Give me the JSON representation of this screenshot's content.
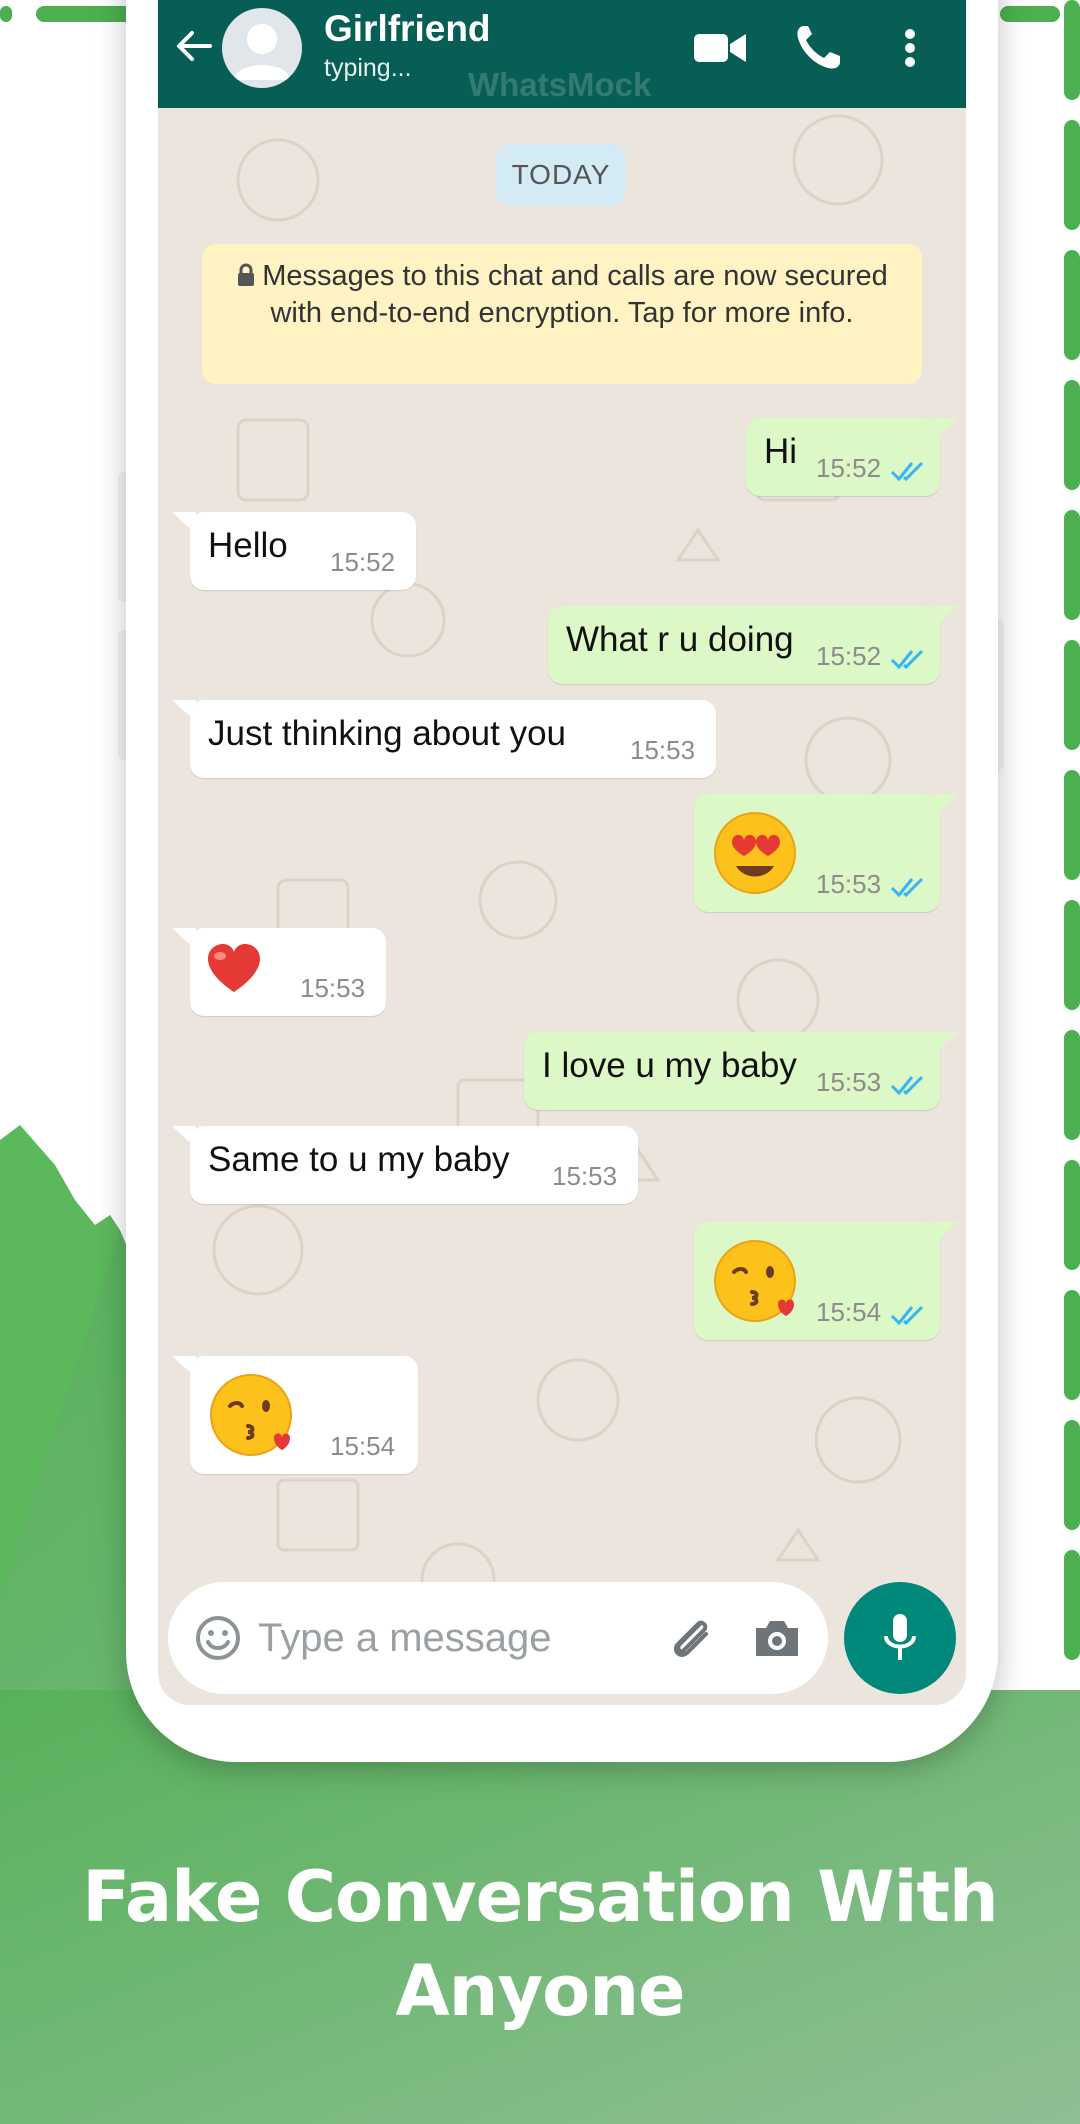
{
  "chat": {
    "contact_name": "Girlfriend",
    "contact_status": "typing...",
    "watermark": "WhatsMock",
    "date_label": "TODAY",
    "encryption_notice": "Messages to this chat and calls are now secured with end-to-end encryption. Tap for more info.",
    "messages": [
      {
        "direction": "out",
        "text": "Hi",
        "time": "15:52",
        "status": "read"
      },
      {
        "direction": "in",
        "text": "Hello",
        "time": "15:52"
      },
      {
        "direction": "out",
        "text": "What r u doing",
        "time": "15:52",
        "status": "read"
      },
      {
        "direction": "in",
        "text": "Just thinking about you",
        "time": "15:53"
      },
      {
        "direction": "out",
        "emoji": "smiling-face-with-heart-eyes",
        "time": "15:53",
        "status": "read"
      },
      {
        "direction": "in",
        "emoji": "red-heart",
        "time": "15:53"
      },
      {
        "direction": "out",
        "text": "I love u my baby",
        "time": "15:53",
        "status": "read"
      },
      {
        "direction": "in",
        "text": "Same to u my baby",
        "time": "15:53"
      },
      {
        "direction": "out",
        "emoji": "face-blowing-a-kiss",
        "time": "15:54",
        "status": "read"
      },
      {
        "direction": "in",
        "emoji": "face-blowing-a-kiss",
        "time": "15:54"
      }
    ]
  },
  "input": {
    "placeholder": "Type a message"
  },
  "promo": {
    "line1": "Fake Conversation With",
    "line2": "Anyone"
  },
  "colors": {
    "header": "#075e54",
    "outgoing_bubble": "#dcf8c6",
    "incoming_bubble": "#ffffff",
    "chat_background": "#ece5dd",
    "mic_button": "#00897b",
    "read_ticks": "#34b7f1",
    "promo_green": "#5cb85c"
  },
  "icons": [
    "back-arrow-icon",
    "avatar-placeholder-icon",
    "video-call-icon",
    "phone-call-icon",
    "more-vertical-icon",
    "lock-icon",
    "read-ticks-icon",
    "emoji-icon",
    "attach-icon",
    "camera-icon",
    "mic-icon"
  ]
}
